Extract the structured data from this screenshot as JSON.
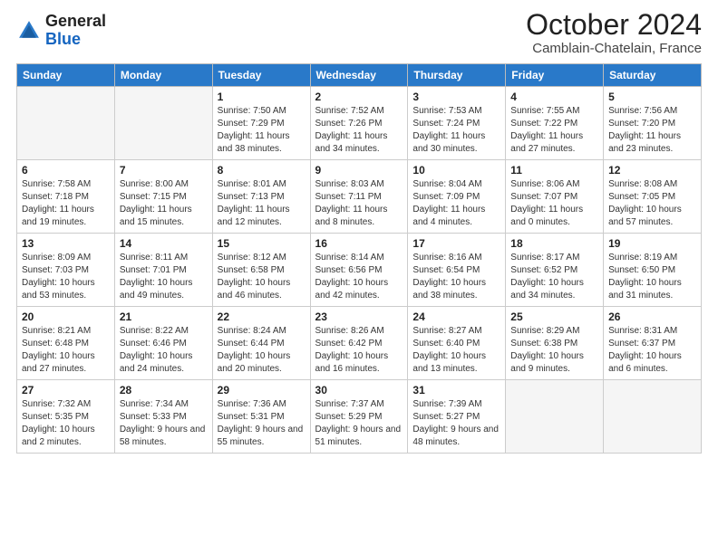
{
  "logo": {
    "general": "General",
    "blue": "Blue"
  },
  "title": "October 2024",
  "subtitle": "Camblain-Chatelain, France",
  "headers": [
    "Sunday",
    "Monday",
    "Tuesday",
    "Wednesday",
    "Thursday",
    "Friday",
    "Saturday"
  ],
  "weeks": [
    [
      {
        "day": "",
        "info": ""
      },
      {
        "day": "",
        "info": ""
      },
      {
        "day": "1",
        "info": "Sunrise: 7:50 AM\nSunset: 7:29 PM\nDaylight: 11 hours and 38 minutes."
      },
      {
        "day": "2",
        "info": "Sunrise: 7:52 AM\nSunset: 7:26 PM\nDaylight: 11 hours and 34 minutes."
      },
      {
        "day": "3",
        "info": "Sunrise: 7:53 AM\nSunset: 7:24 PM\nDaylight: 11 hours and 30 minutes."
      },
      {
        "day": "4",
        "info": "Sunrise: 7:55 AM\nSunset: 7:22 PM\nDaylight: 11 hours and 27 minutes."
      },
      {
        "day": "5",
        "info": "Sunrise: 7:56 AM\nSunset: 7:20 PM\nDaylight: 11 hours and 23 minutes."
      }
    ],
    [
      {
        "day": "6",
        "info": "Sunrise: 7:58 AM\nSunset: 7:18 PM\nDaylight: 11 hours and 19 minutes."
      },
      {
        "day": "7",
        "info": "Sunrise: 8:00 AM\nSunset: 7:15 PM\nDaylight: 11 hours and 15 minutes."
      },
      {
        "day": "8",
        "info": "Sunrise: 8:01 AM\nSunset: 7:13 PM\nDaylight: 11 hours and 12 minutes."
      },
      {
        "day": "9",
        "info": "Sunrise: 8:03 AM\nSunset: 7:11 PM\nDaylight: 11 hours and 8 minutes."
      },
      {
        "day": "10",
        "info": "Sunrise: 8:04 AM\nSunset: 7:09 PM\nDaylight: 11 hours and 4 minutes."
      },
      {
        "day": "11",
        "info": "Sunrise: 8:06 AM\nSunset: 7:07 PM\nDaylight: 11 hours and 0 minutes."
      },
      {
        "day": "12",
        "info": "Sunrise: 8:08 AM\nSunset: 7:05 PM\nDaylight: 10 hours and 57 minutes."
      }
    ],
    [
      {
        "day": "13",
        "info": "Sunrise: 8:09 AM\nSunset: 7:03 PM\nDaylight: 10 hours and 53 minutes."
      },
      {
        "day": "14",
        "info": "Sunrise: 8:11 AM\nSunset: 7:01 PM\nDaylight: 10 hours and 49 minutes."
      },
      {
        "day": "15",
        "info": "Sunrise: 8:12 AM\nSunset: 6:58 PM\nDaylight: 10 hours and 46 minutes."
      },
      {
        "day": "16",
        "info": "Sunrise: 8:14 AM\nSunset: 6:56 PM\nDaylight: 10 hours and 42 minutes."
      },
      {
        "day": "17",
        "info": "Sunrise: 8:16 AM\nSunset: 6:54 PM\nDaylight: 10 hours and 38 minutes."
      },
      {
        "day": "18",
        "info": "Sunrise: 8:17 AM\nSunset: 6:52 PM\nDaylight: 10 hours and 34 minutes."
      },
      {
        "day": "19",
        "info": "Sunrise: 8:19 AM\nSunset: 6:50 PM\nDaylight: 10 hours and 31 minutes."
      }
    ],
    [
      {
        "day": "20",
        "info": "Sunrise: 8:21 AM\nSunset: 6:48 PM\nDaylight: 10 hours and 27 minutes."
      },
      {
        "day": "21",
        "info": "Sunrise: 8:22 AM\nSunset: 6:46 PM\nDaylight: 10 hours and 24 minutes."
      },
      {
        "day": "22",
        "info": "Sunrise: 8:24 AM\nSunset: 6:44 PM\nDaylight: 10 hours and 20 minutes."
      },
      {
        "day": "23",
        "info": "Sunrise: 8:26 AM\nSunset: 6:42 PM\nDaylight: 10 hours and 16 minutes."
      },
      {
        "day": "24",
        "info": "Sunrise: 8:27 AM\nSunset: 6:40 PM\nDaylight: 10 hours and 13 minutes."
      },
      {
        "day": "25",
        "info": "Sunrise: 8:29 AM\nSunset: 6:38 PM\nDaylight: 10 hours and 9 minutes."
      },
      {
        "day": "26",
        "info": "Sunrise: 8:31 AM\nSunset: 6:37 PM\nDaylight: 10 hours and 6 minutes."
      }
    ],
    [
      {
        "day": "27",
        "info": "Sunrise: 7:32 AM\nSunset: 5:35 PM\nDaylight: 10 hours and 2 minutes."
      },
      {
        "day": "28",
        "info": "Sunrise: 7:34 AM\nSunset: 5:33 PM\nDaylight: 9 hours and 58 minutes."
      },
      {
        "day": "29",
        "info": "Sunrise: 7:36 AM\nSunset: 5:31 PM\nDaylight: 9 hours and 55 minutes."
      },
      {
        "day": "30",
        "info": "Sunrise: 7:37 AM\nSunset: 5:29 PM\nDaylight: 9 hours and 51 minutes."
      },
      {
        "day": "31",
        "info": "Sunrise: 7:39 AM\nSunset: 5:27 PM\nDaylight: 9 hours and 48 minutes."
      },
      {
        "day": "",
        "info": ""
      },
      {
        "day": "",
        "info": ""
      }
    ]
  ]
}
